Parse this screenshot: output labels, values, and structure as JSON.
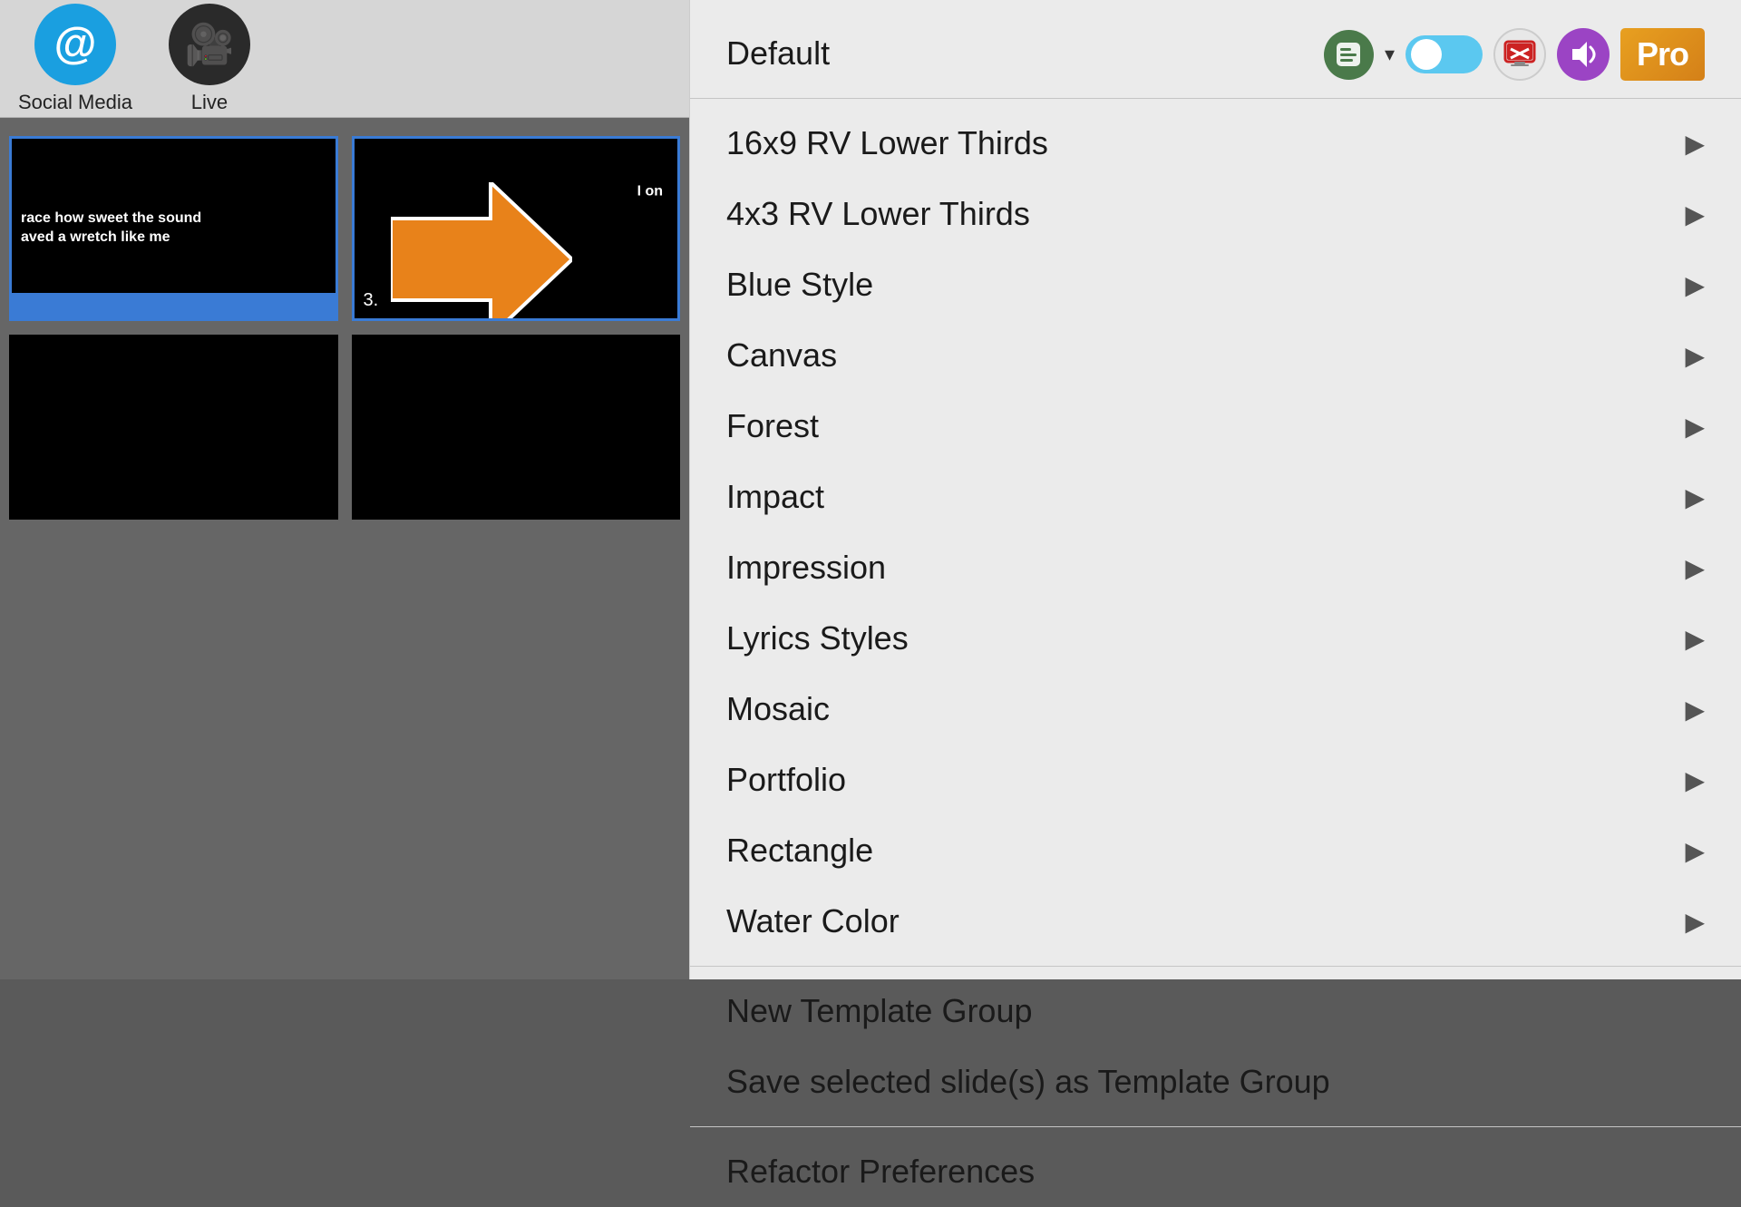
{
  "toolbar": {
    "items": [
      {
        "label": "Social Media",
        "icon": "@",
        "icon_type": "blue"
      },
      {
        "label": "Live",
        "icon": "🎥",
        "icon_type": "dark"
      }
    ]
  },
  "slides": [
    {
      "id": 1,
      "text": "race how sweet the sound\naved a wretch like me",
      "number": null,
      "active": true,
      "has_blue_bar": true
    },
    {
      "id": 2,
      "text": "I on",
      "number": "3.",
      "active": true,
      "has_blue_bar": false
    },
    {
      "id": 3,
      "text": "",
      "number": null,
      "active": false,
      "has_blue_bar": false
    },
    {
      "id": 4,
      "text": "",
      "number": null,
      "active": false,
      "has_blue_bar": false
    }
  ],
  "menu": {
    "items": [
      {
        "label": "Default",
        "has_arrow": true,
        "highlighted": false,
        "divider_before": false
      },
      {
        "label": "16x9 RV Lower Thirds",
        "has_arrow": true,
        "highlighted": false,
        "divider_before": true
      },
      {
        "label": "4x3 RV Lower Thirds",
        "has_arrow": true,
        "highlighted": false,
        "divider_before": false
      },
      {
        "label": "Blue Style",
        "has_arrow": true,
        "highlighted": false,
        "divider_before": false
      },
      {
        "label": "Canvas",
        "has_arrow": true,
        "highlighted": false,
        "divider_before": false
      },
      {
        "label": "Forest",
        "has_arrow": true,
        "highlighted": false,
        "divider_before": false
      },
      {
        "label": "Impact",
        "has_arrow": true,
        "highlighted": false,
        "divider_before": false
      },
      {
        "label": "Impression",
        "has_arrow": true,
        "highlighted": false,
        "divider_before": false
      },
      {
        "label": "Lyrics Styles",
        "has_arrow": true,
        "highlighted": false,
        "divider_before": false
      },
      {
        "label": "Mosaic",
        "has_arrow": true,
        "highlighted": false,
        "divider_before": false
      },
      {
        "label": "Portfolio",
        "has_arrow": true,
        "highlighted": false,
        "divider_before": false
      },
      {
        "label": "Rectangle",
        "has_arrow": true,
        "highlighted": false,
        "divider_before": false
      },
      {
        "label": "Water Color",
        "has_arrow": true,
        "highlighted": false,
        "divider_before": false
      },
      {
        "label": "New Template Group",
        "has_arrow": false,
        "highlighted": false,
        "divider_before": true
      },
      {
        "label": "Save selected slide(s) as Template Group",
        "has_arrow": false,
        "highlighted": false,
        "divider_before": false
      },
      {
        "label": "Refactor Preferences",
        "has_arrow": false,
        "highlighted": false,
        "divider_before": true
      }
    ]
  },
  "icons": {
    "chevron_right": "▶",
    "chevron_down": "⌄",
    "social_at": "@",
    "camera": "📹"
  }
}
